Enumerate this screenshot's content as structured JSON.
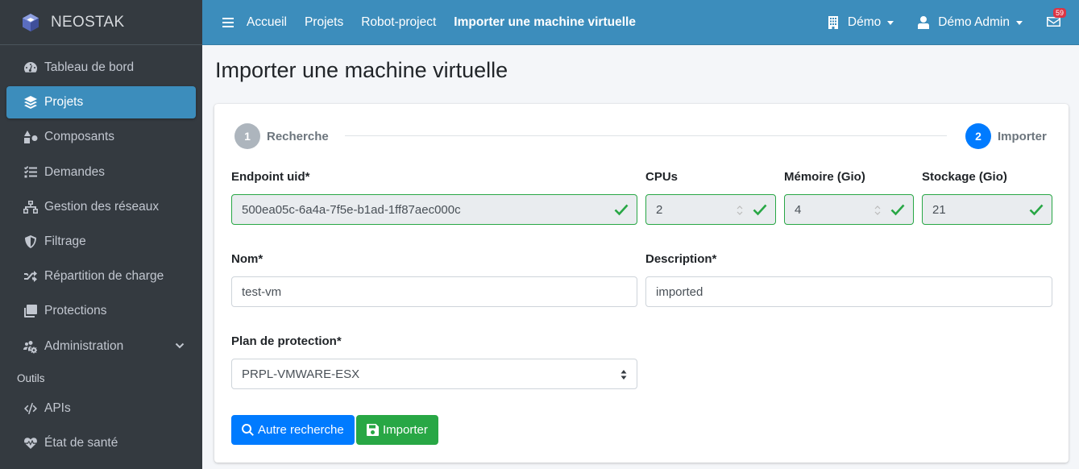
{
  "brand": {
    "name_part1": "NEO",
    "name_part2": "STAK"
  },
  "sidebar": {
    "items": [
      {
        "label": "Tableau de bord",
        "icon": "tachometer-icon"
      },
      {
        "label": "Projets",
        "icon": "layers-icon",
        "active": true
      },
      {
        "label": "Composants",
        "icon": "shapes-icon"
      },
      {
        "label": "Demandes",
        "icon": "tasks-icon"
      },
      {
        "label": "Gestion des réseaux",
        "icon": "sitemap-icon"
      },
      {
        "label": "Filtrage",
        "icon": "shield-icon"
      },
      {
        "label": "Répartition de charge",
        "icon": "random-icon"
      },
      {
        "label": "Protections",
        "icon": "copy-icon"
      },
      {
        "label": "Administration",
        "icon": "users-cog-icon"
      }
    ],
    "tools_header": "Outils",
    "tools": [
      {
        "label": "APIs",
        "icon": "code-icon"
      },
      {
        "label": "État de santé",
        "icon": "heartbeat-icon"
      }
    ]
  },
  "topbar": {
    "breadcrumbs": [
      "Accueil",
      "Projets",
      "Robot-project",
      "Importer une machine virtuelle"
    ],
    "org": "Démo",
    "user": "Démo Admin",
    "notifications": "59"
  },
  "page": {
    "title": "Importer une machine virtuelle"
  },
  "stepper": {
    "steps": [
      {
        "number": "1",
        "label": "Recherche"
      },
      {
        "number": "2",
        "label": "Importer"
      }
    ]
  },
  "form": {
    "endpoint_label": "Endpoint uid*",
    "endpoint_value": "500ea05c-6a4a-7f5e-b1ad-1ff87aec000c",
    "cpus_label": "CPUs",
    "cpus_value": "2",
    "memory_label": "Mémoire (Gio)",
    "memory_value": "4",
    "storage_label": "Stockage (Gio)",
    "storage_value": "21",
    "name_label": "Nom*",
    "name_value": "test-vm",
    "description_label": "Description*",
    "description_value": "imported",
    "plan_label": "Plan de protection*",
    "plan_value": "PRPL-VMWARE-ESX"
  },
  "buttons": {
    "search_again": "Autre recherche",
    "import": "Importer"
  },
  "colors": {
    "sidebar_bg": "#343a40",
    "topbar_bg": "#3c8dbc",
    "primary": "#007bff",
    "success": "#28a745",
    "badge": "#dc3545"
  }
}
